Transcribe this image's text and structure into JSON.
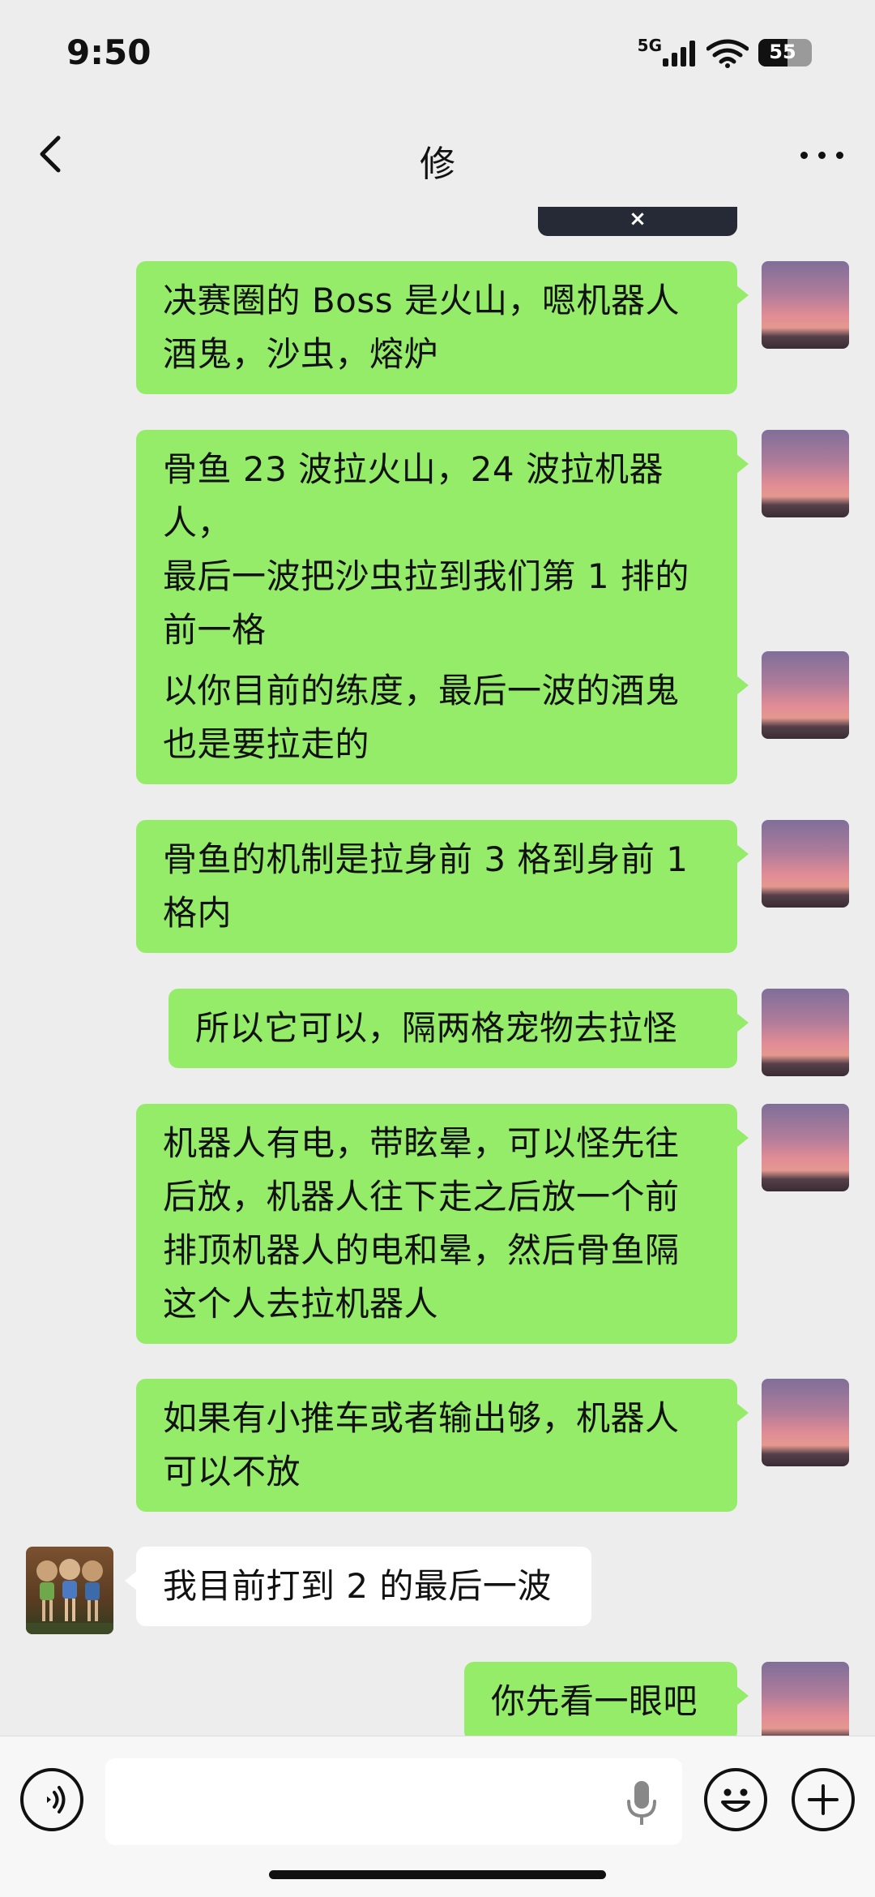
{
  "status_bar": {
    "time": "9:50",
    "network": "5G",
    "battery_percent": "55",
    "battery_level": 0.55
  },
  "header": {
    "title": "修",
    "back_icon": "chevron-left-icon",
    "more_icon": "more-horizontal-icon"
  },
  "colors": {
    "outgoing_bubble": "#95ec69",
    "incoming_bubble": "#ffffff",
    "background": "#ededed"
  },
  "messages": [
    {
      "dir": "out",
      "lines": [
        "决赛圈的 Boss 是火山，嗯机器人",
        "酒鬼，沙虫，熔炉"
      ]
    },
    {
      "dir": "out",
      "lines": [
        "骨鱼 23 波拉火山，24 波拉机器人，",
        "最后一波把沙虫拉到我们第 1 排的",
        "前一格"
      ]
    },
    {
      "dir": "out",
      "lines": [
        "以你目前的练度，最后一波的酒鬼",
        "也是要拉走的"
      ]
    },
    {
      "dir": "out",
      "lines": [
        "骨鱼的机制是拉身前 3 格到身前 1",
        "格内"
      ]
    },
    {
      "dir": "out",
      "lines": [
        "所以它可以，隔两格宠物去拉怪"
      ]
    },
    {
      "dir": "out",
      "lines": [
        "机器人有电，带眩晕，可以怪先往",
        "后放，机器人往下走之后放一个前",
        "排顶机器人的电和晕，然后骨鱼隔",
        "这个人去拉机器人"
      ]
    },
    {
      "dir": "out",
      "lines": [
        "如果有小推车或者输出够，机器人",
        "可以不放"
      ]
    },
    {
      "dir": "in",
      "lines": [
        "我目前打到 2 的最后一波"
      ]
    },
    {
      "dir": "out",
      "lines": [
        "你先看一眼吧"
      ]
    }
  ],
  "video_card": {
    "close_glyph": "×"
  },
  "input_bar": {
    "voice_icon": "voice-icon",
    "mic_icon": "microphone-icon",
    "emoji_icon": "emoji-icon",
    "plus_icon": "plus-icon",
    "placeholder": ""
  }
}
